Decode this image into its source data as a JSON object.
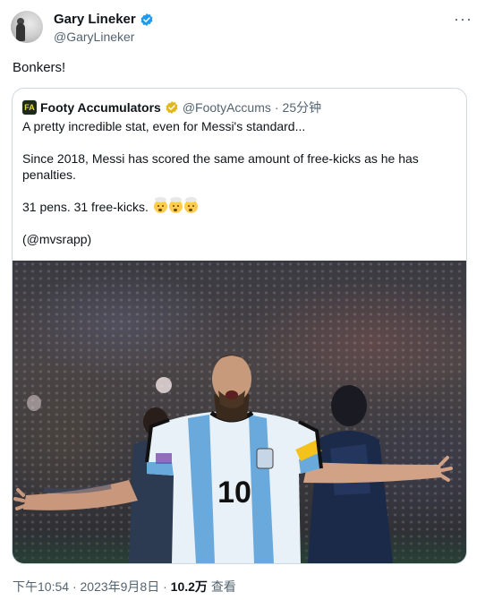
{
  "author": {
    "name": "Gary Lineker",
    "handle": "@GaryLineker",
    "verified_color": "#1d9bf0"
  },
  "tweet": {
    "text": "Bonkers!"
  },
  "quoted": {
    "logo_text": "FA",
    "name": "Footy Accumulators",
    "handle": "@FootyAccums",
    "separator": "·",
    "time": "25分钟",
    "verified_color": "#e2b719",
    "lines": [
      "A pretty incredible stat, even for Messi's standard...",
      "Since 2018, Messi has scored the same amount of free-kicks as he has penalties.",
      "31 pens. 31 free-kicks.",
      "(@mvsrapp)"
    ],
    "emoji_name": "exploding-head-emoji",
    "emoji_count": 3,
    "image": {
      "description_icon": "photo",
      "jersey_number": "10"
    }
  },
  "footer": {
    "time": "下午10:54",
    "separator": "·",
    "date": "2023年9月8日",
    "views_count": "10.2万",
    "views_label": "查看"
  },
  "more_icon": "more-icon"
}
